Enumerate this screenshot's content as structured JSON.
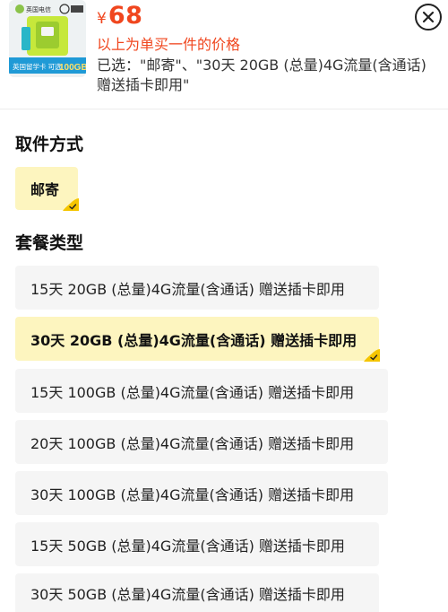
{
  "header": {
    "price_symbol": "¥",
    "price": "68",
    "price_note": "以上为单买一件的价格",
    "selected_summary": "已选：\"邮寄\"、\"30天 20GB (总量)4G流量(含通话) 赠送插卡即用\"",
    "thumbnail": {
      "brand": "英国电信",
      "caption": "英国留学卡 可选",
      "caption_highlight": "100GB"
    }
  },
  "delivery": {
    "title": "取件方式",
    "options": [
      {
        "label": "邮寄",
        "selected": true
      }
    ]
  },
  "plans": {
    "title": "套餐类型",
    "options": [
      {
        "label": "15天 20GB (总量)4G流量(含通话) 赠送插卡即用",
        "selected": false
      },
      {
        "label": "30天 20GB (总量)4G流量(含通话) 赠送插卡即用",
        "selected": true
      },
      {
        "label": "15天 100GB (总量)4G流量(含通话) 赠送插卡即用",
        "selected": false
      },
      {
        "label": "20天 100GB (总量)4G流量(含通话) 赠送插卡即用",
        "selected": false
      },
      {
        "label": "30天 100GB (总量)4G流量(含通话) 赠送插卡即用",
        "selected": false
      },
      {
        "label": "15天 50GB (总量)4G流量(含通话) 赠送插卡即用",
        "selected": false
      },
      {
        "label": "30天 50GB (总量)4G流量(含通话) 赠送插卡即用",
        "selected": false
      }
    ]
  },
  "colors": {
    "price": "#f0461e",
    "selected_bg": "#fdf5bf",
    "option_bg": "#f5f5f5",
    "check": "#f5c500"
  }
}
